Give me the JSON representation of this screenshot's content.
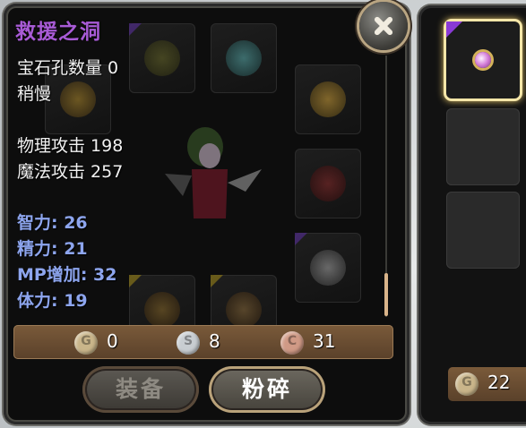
{
  "item": {
    "name": "救援之洞",
    "name_color": "#a85bd6",
    "gem_slots": "宝石孔数量 0",
    "speed": "稍慢",
    "physical_attack": "物理攻击 198",
    "magic_attack": "魔法攻击 257",
    "stats": [
      "智力: 26",
      "精力: 21",
      "MP增加: 32",
      "体力: 19"
    ],
    "stat_color": "#8da5ee"
  },
  "currency": {
    "gold_icon": "G",
    "gold": "0",
    "silver_icon": "S",
    "silver": "8",
    "copper_icon": "C",
    "copper": "31"
  },
  "buttons": {
    "equip": "装备",
    "smash": "粉碎"
  },
  "inventory": {
    "gold_icon": "G",
    "gold": "22"
  }
}
